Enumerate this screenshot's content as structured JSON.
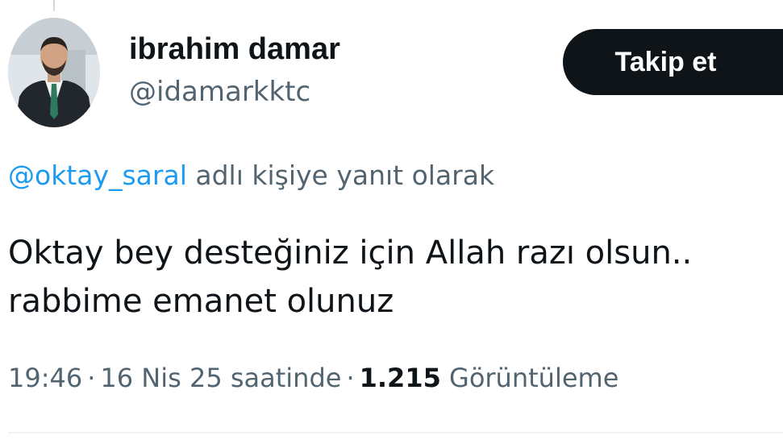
{
  "tweet": {
    "author": {
      "display_name": "ibrahim damar",
      "handle": "@idamarkktc"
    },
    "follow_label": "Takip et",
    "reply_to": {
      "mention": "@oktay_saral",
      "suffix": "adlı kişiye yanıt olarak"
    },
    "text_lines": [
      "Oktay bey desteğiniz için Allah razı olsun..",
      "rabbime emanet olunuz"
    ],
    "meta": {
      "time": "19:46",
      "separator": "·",
      "date": "16 Nis 25 saatinde",
      "views_count": "1.215",
      "views_label": "Görüntüleme"
    }
  },
  "icons": {
    "avatar": "profile-photo"
  },
  "colors": {
    "text_primary": "#0f1419",
    "text_secondary": "#536471",
    "link": "#1d9bf0",
    "button_bg": "#0f1419",
    "button_text": "#ffffff"
  }
}
